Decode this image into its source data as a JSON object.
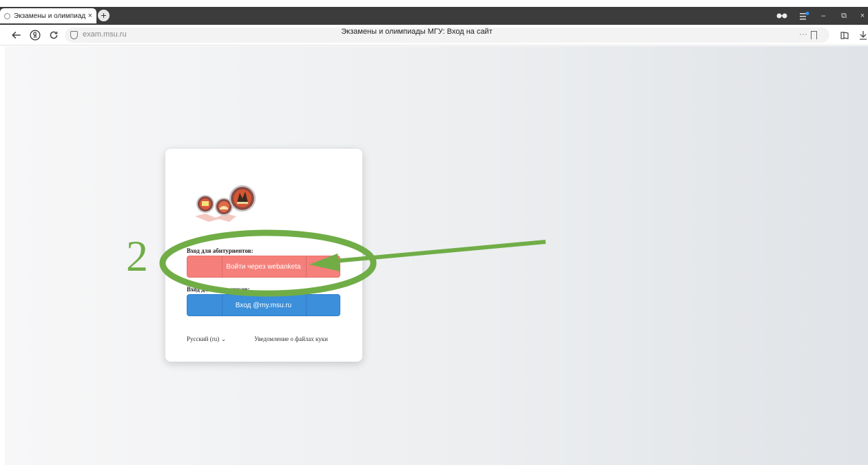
{
  "browser": {
    "tab_title": "Экзамены и олимпиад",
    "tab_close": "×",
    "new_tab": "+",
    "url": "exam.msu.ru",
    "page_title": "Экзамены и олимпиады МГУ: Вход на сайт",
    "url_more": "···",
    "window_controls": [
      "‒",
      "⧉",
      "×"
    ]
  },
  "login": {
    "applicants_label": "Вход для абитуриентов:",
    "applicants_button": "Войти через webanketa",
    "staff_label": "Вход для сотрудников:",
    "staff_button": "Вход @my.msu.ru",
    "language": "Русский (ru)",
    "cookie_notice": "Уведомление о файлах куки"
  },
  "annotation": {
    "step_number": "2",
    "color": "#70ad47"
  },
  "colors": {
    "applicants_button": "#f57f7a",
    "staff_button": "#3b8fdb"
  }
}
